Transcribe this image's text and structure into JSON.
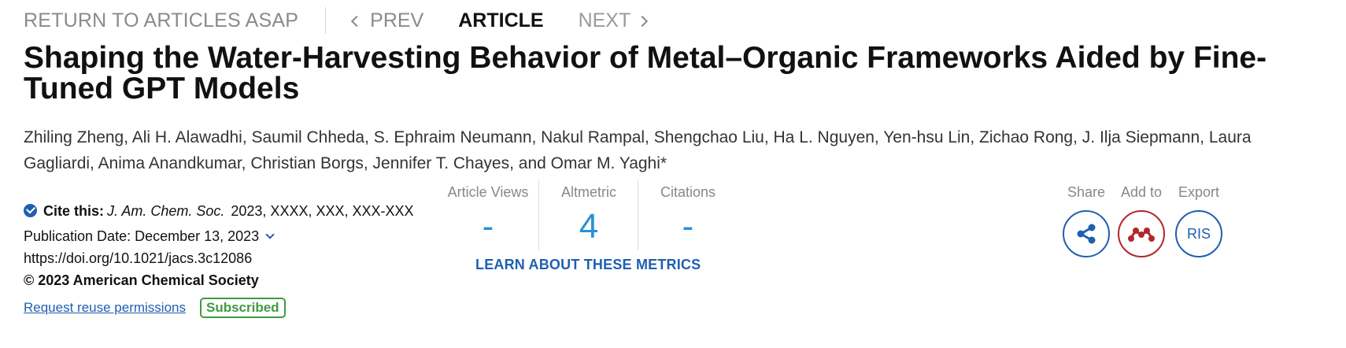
{
  "nav": {
    "return_label": "RETURN TO ARTICLES ASAP",
    "prev_label": "PREV",
    "article_label": "ARTICLE",
    "next_label": "NEXT"
  },
  "article": {
    "title": "Shaping the Water-Harvesting Behavior of Metal–Organic Frameworks Aided by Fine-Tuned GPT Models",
    "authors": "Zhiling Zheng, Ali H. Alawadhi, Saumil Chheda, S. Ephraim Neumann, Nakul Rampal, Shengchao Liu, Ha L. Nguyen, Yen-hsu Lin, Zichao Rong, J. Ilja Siepmann, Laura Gagliardi, Anima Anandkumar, Christian Borgs, Jennifer T. Chayes, and Omar M. Yaghi*"
  },
  "citation": {
    "cite_label": "Cite this:",
    "journal": "J. Am. Chem. Soc.",
    "cite_values": "2023, XXXX, XXX, XXX-XXX",
    "publication_date": "Publication Date: December 13, 2023",
    "doi": "https://doi.org/10.1021/jacs.3c12086",
    "copyright": "© 2023 American Chemical Society",
    "reuse_link": "Request reuse permissions",
    "subscribed_badge": "Subscribed"
  },
  "metrics": {
    "views_label": "Article Views",
    "views_value": "-",
    "altmetric_label": "Altmetric",
    "altmetric_value": "4",
    "citations_label": "Citations",
    "citations_value": "-",
    "learn_link": "LEARN ABOUT THESE METRICS"
  },
  "actions": {
    "share_label": "Share",
    "add_label": "Add to",
    "export_label": "Export",
    "export_button": "RIS"
  },
  "colors": {
    "accent": "#1f5fb0",
    "metric_value": "#2a8fd8",
    "mendeley": "#b3262a",
    "subscribed": "#3f9a3f"
  },
  "icons": {
    "share": "share-icon",
    "add_to": "mendeley-icon",
    "check": "check-circle-icon"
  }
}
